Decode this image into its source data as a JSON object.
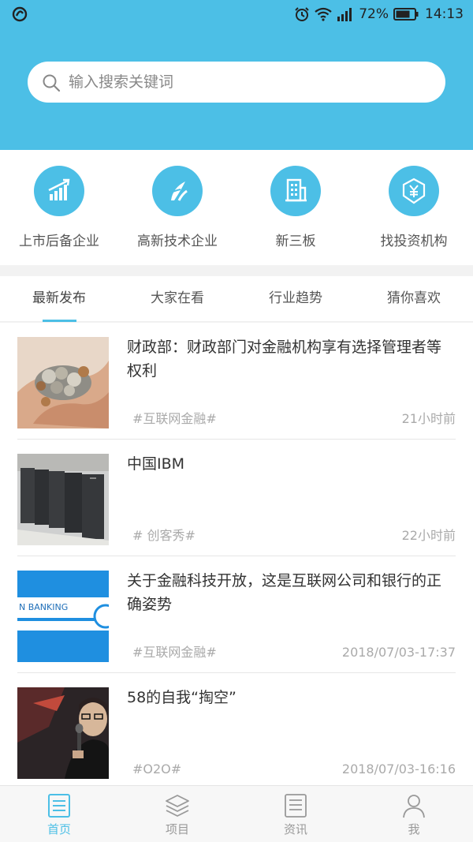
{
  "colors": {
    "accent": "#4cbfe6",
    "header_bg": "#4cbfe6",
    "muted": "#aaaaaa"
  },
  "status_bar": {
    "battery": "72%",
    "time": "14:13",
    "icons": [
      "app-logo-icon",
      "alarm-icon",
      "wifi-icon",
      "signal-icon",
      "battery-icon"
    ]
  },
  "search": {
    "placeholder": "输入搜索关键词"
  },
  "categories": [
    {
      "label": "上市后备企业",
      "icon": "growth-chart-icon"
    },
    {
      "label": "高新技术企业",
      "icon": "tech-leaf-icon"
    },
    {
      "label": "新三板",
      "icon": "building-icon"
    },
    {
      "label": "找投资机构",
      "icon": "yen-shield-icon"
    }
  ],
  "tabs": [
    {
      "label": "最新发布",
      "active": true
    },
    {
      "label": "大家在看",
      "active": false
    },
    {
      "label": "行业趋势",
      "active": false
    },
    {
      "label": "猜你喜欢",
      "active": false
    }
  ],
  "feed": [
    {
      "title": "财政部：财政部门对金融机构享有选择管理者等权利",
      "tag": "#互联网金融#",
      "time": "21小时前",
      "thumb": "coins-in-hands"
    },
    {
      "title": "中国IBM",
      "tag": "# 创客秀#",
      "time": "22小时前",
      "thumb": "server-racks"
    },
    {
      "title": "关于金融科技开放，这是互联网公司和银行的正确姿势",
      "tag": "#互联网金融#",
      "time": "2018/07/03-17:37",
      "thumb": "banking-banner",
      "thumb_text": "N BANKING"
    },
    {
      "title": "58的自我“掏空”",
      "tag": "#O2O#",
      "time": "2018/07/03-16:16",
      "thumb": "speaker-with-mic"
    }
  ],
  "bottom_nav": [
    {
      "label": "首页",
      "icon": "home-doc-icon",
      "active": true
    },
    {
      "label": "项目",
      "icon": "layers-icon",
      "active": false
    },
    {
      "label": "资讯",
      "icon": "news-doc-icon",
      "active": false
    },
    {
      "label": "我",
      "icon": "person-icon",
      "active": false
    }
  ]
}
